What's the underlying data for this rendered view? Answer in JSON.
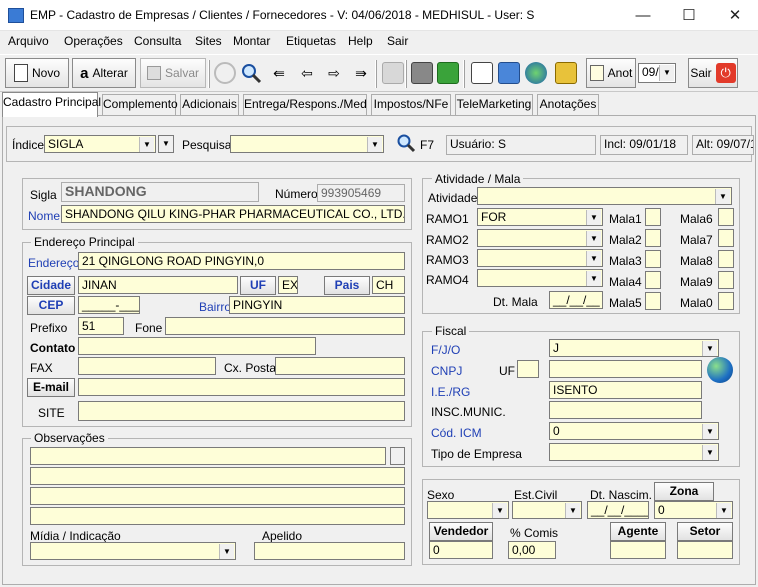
{
  "window": {
    "title": "EMP - Cadastro de Empresas / Clientes / Fornecedores - V: 04/06/2018 - MEDHISUL - User: S",
    "minimize": "—",
    "maximize": "☐",
    "close": "✕"
  },
  "menu": [
    "Arquivo",
    "Operações",
    "Consulta",
    "Sites",
    "Montar",
    "Etiquetas",
    "Help",
    "Sair"
  ],
  "toolbar": {
    "novo": "Novo",
    "alterar": "Alterar",
    "salvar": "Salvar",
    "anot": "Anot",
    "page_value": "09/",
    "sair": "Sair"
  },
  "tabs": [
    "Cadastro Principal",
    "Complemento",
    "Adicionais",
    "Entrega/Respons./Med",
    "Impostos/NFe",
    "TeleMarketing",
    "Anotações"
  ],
  "search": {
    "indice_label": "Índice",
    "indice_value": "SIGLA",
    "pesquisa_label": "Pesquisa",
    "pesquisa_value": "",
    "f7": "F7",
    "usuario": "Usuário: S",
    "incl": "Incl: 09/01/18",
    "alt": "Alt: 09/07/1"
  },
  "empresa": {
    "sigla_label": "Sigla",
    "sigla": "SHANDONG",
    "numero_label": "Número",
    "numero": "993905469",
    "nome_label": "Nome",
    "nome": "SHANDONG QILU KING-PHAR PHARMACEUTICAL CO., LTD."
  },
  "endereco": {
    "group": "Endereço Principal",
    "endereco_label": "Endereço",
    "endereco": "21 QINGLONG ROAD PINGYIN,0",
    "cidade_btn": "Cidade",
    "cidade": "JINAN",
    "uf_btn": "UF",
    "uf": "EX",
    "pais_btn": "Pais",
    "pais": "CH",
    "cep_btn": "CEP",
    "cep": "_____-___",
    "bairro_label": "Bairro",
    "bairro": "PINGYIN",
    "prefixo_label": "Prefixo",
    "prefixo": "51",
    "fone_label": "Fone",
    "fone": "",
    "contato_label": "Contato",
    "contato": "",
    "fax_label": "FAX",
    "fax": "",
    "cxpostal_label": "Cx. Postal",
    "cxpostal": "",
    "email_btn": "E-mail",
    "email": "",
    "site_label": "SITE",
    "site": ""
  },
  "obs": {
    "group": "Observações",
    "midia_label": "Mídia / Indicação",
    "midia": "",
    "apelido_label": "Apelido",
    "apelido": ""
  },
  "atividade": {
    "group": "Atividade / Mala",
    "atividade_label": "Atividade",
    "atividade": "",
    "ramos": [
      {
        "label": "RAMO1",
        "value": "FOR"
      },
      {
        "label": "RAMO2",
        "value": ""
      },
      {
        "label": "RAMO3",
        "value": ""
      },
      {
        "label": "RAMO4",
        "value": ""
      }
    ],
    "malas_left": [
      "Mala1",
      "Mala2",
      "Mala3",
      "Mala4",
      "Mala5"
    ],
    "malas_right": [
      "Mala6",
      "Mala7",
      "Mala8",
      "Mala9",
      "Mala0"
    ],
    "dtmala_label": "Dt. Mala",
    "dtmala": "__/__/__"
  },
  "fiscal": {
    "group": "Fiscal",
    "fjo_label": "F/J/O",
    "fjo": "J",
    "cnpj_label": "CNPJ",
    "uf_label": "UF",
    "uf": "",
    "cnpj": "",
    "ie_label": "I.E./RG",
    "ie": "ISENTO",
    "insc_label": "INSC.MUNIC.",
    "insc": "",
    "icm_label": "Cód. ICM",
    "icm": "0",
    "tipo_label": "Tipo de Empresa",
    "tipo": ""
  },
  "pessoal": {
    "sexo_label": "Sexo",
    "estcivil_label": "Est.Civil",
    "dtnasc_label": "Dt. Nascim.",
    "dtnasc": "__/__/____",
    "zona_btn": "Zona",
    "zona": "0",
    "vendedor_btn": "Vendedor",
    "vendedor": "0",
    "comis_label": "% Comis",
    "comis": "0,00",
    "agente_btn": "Agente",
    "setor_btn": "Setor"
  }
}
